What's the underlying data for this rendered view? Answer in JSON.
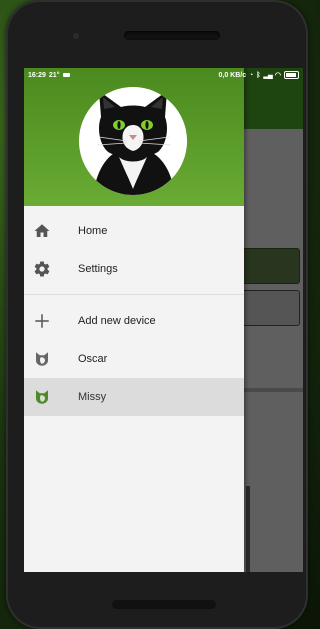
{
  "status_bar": {
    "time": "16:29",
    "temp": "21°",
    "net_speed": "0,0 KB/c",
    "battery": "98"
  },
  "drawer": {
    "items": [
      {
        "label": "Home",
        "icon": "home-icon"
      },
      {
        "label": "Settings",
        "icon": "gear-icon"
      },
      {
        "label": "Add new device",
        "icon": "plus-icon"
      },
      {
        "label": "Oscar",
        "icon": "cat-icon"
      },
      {
        "label": "Missy",
        "icon": "cat-icon",
        "selected": true
      }
    ]
  },
  "colors": {
    "header_green": "#5b9c2a",
    "drawer_bg": "#f3f3f3",
    "selected_bg": "#dcdcdc",
    "cat_eye": "#7fd02a"
  }
}
